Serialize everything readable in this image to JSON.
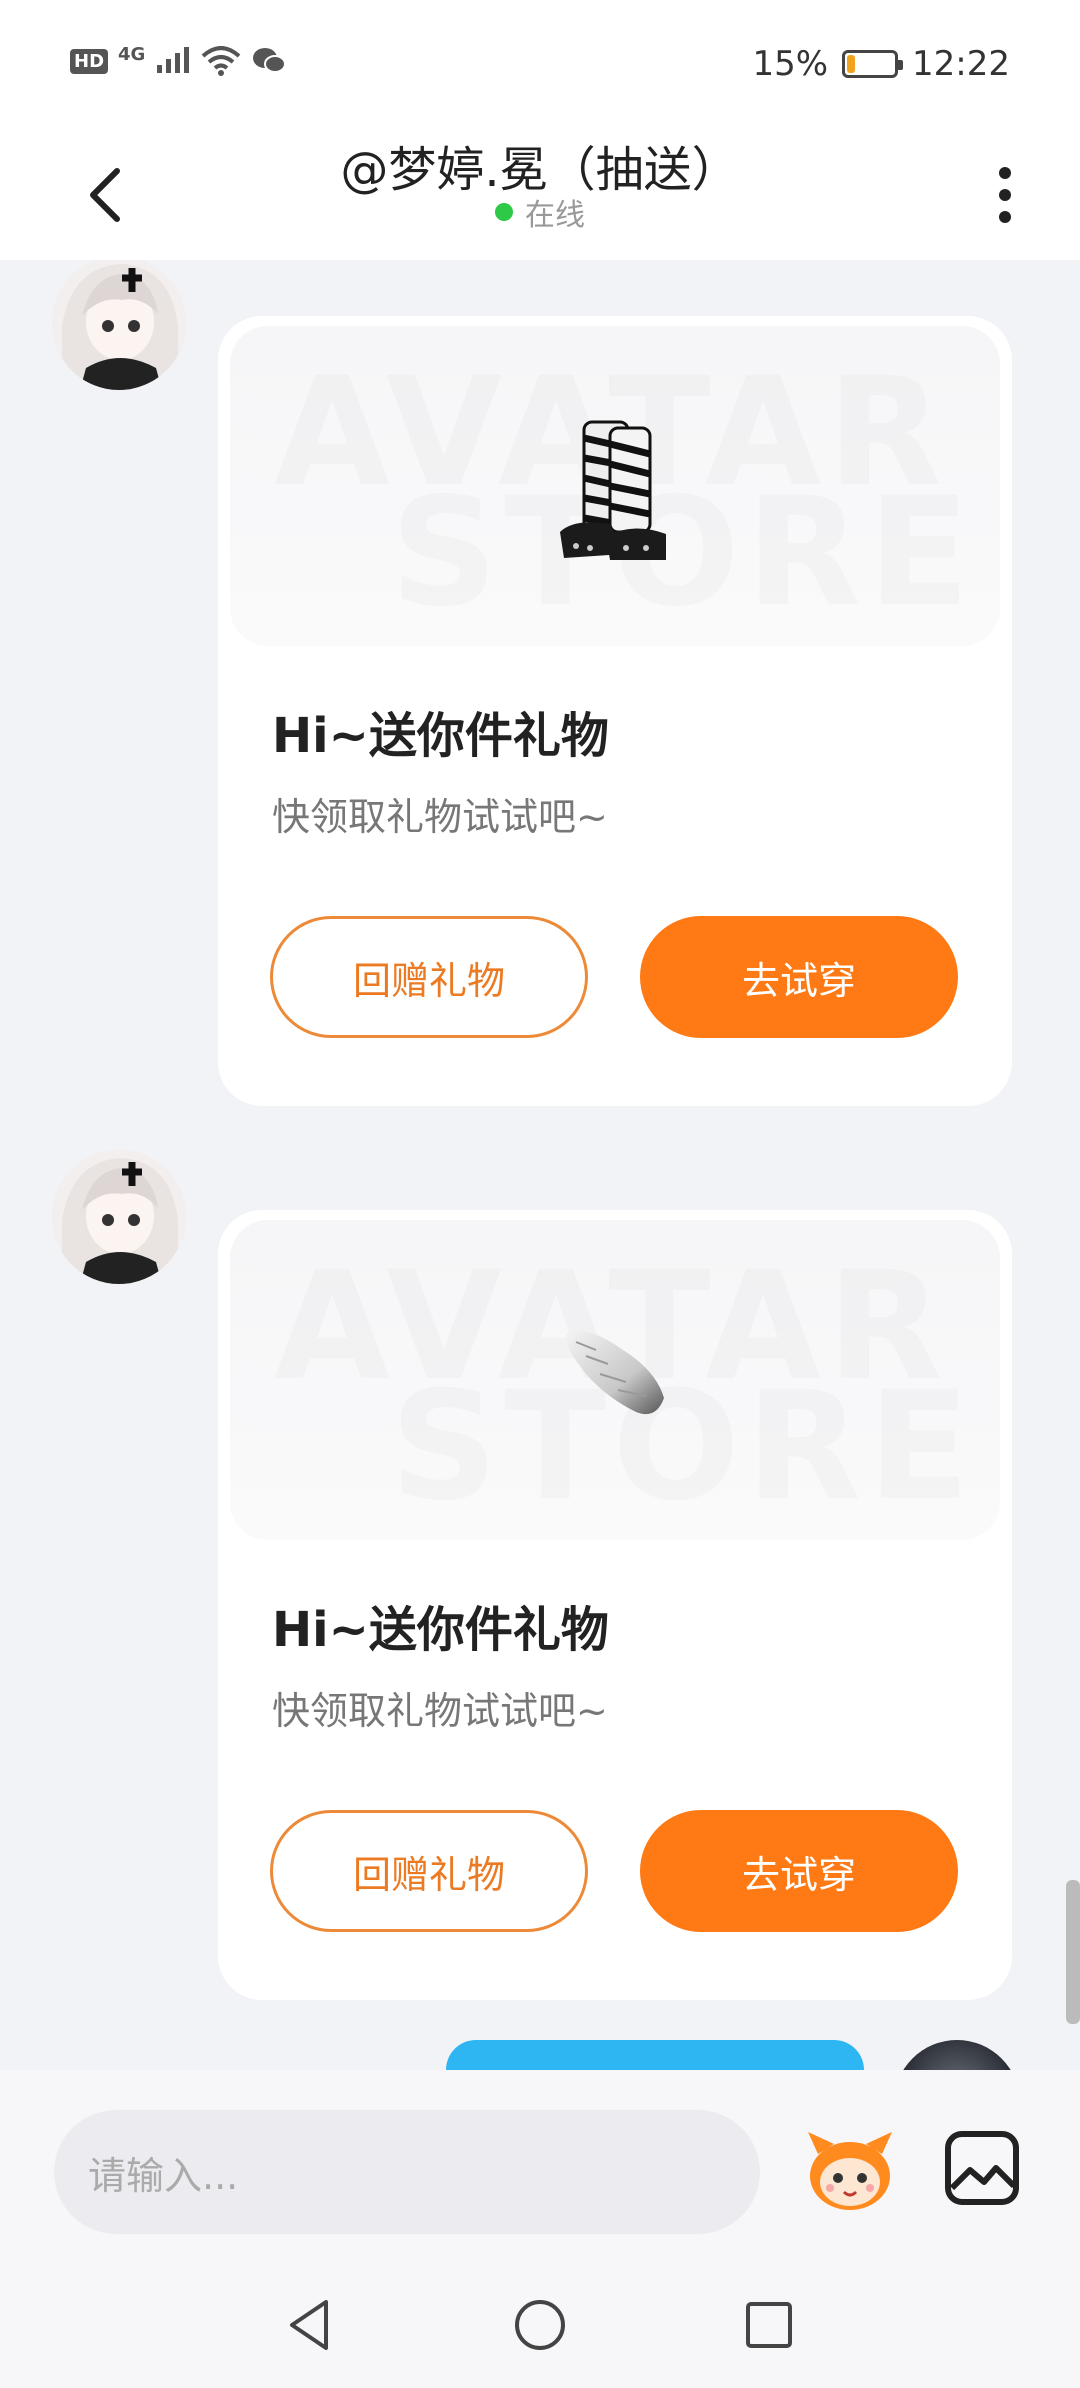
{
  "status_bar": {
    "network_badge": "HD",
    "network_type": "4G",
    "battery_percent_text": "15%",
    "battery_level": 0.15,
    "time": "12:22",
    "icons": [
      "hd-icon",
      "signal-icon",
      "wifi-icon",
      "wechat-icon",
      "battery-icon"
    ]
  },
  "header": {
    "title": "@梦婷.冕（抽送）",
    "status": "在线",
    "status_color": "#2ec946",
    "back_icon": "chevron-left-icon",
    "more_icon": "more-vertical-icon"
  },
  "messages": [
    {
      "type": "gift_card",
      "item": "zebra-boots-icon",
      "banner_text": [
        "AVATAR",
        "STORE"
      ],
      "title": "Hi~送你件礼物",
      "subtitle": "快领取礼物试试吧~",
      "buttons": {
        "return_gift": "回赠礼物",
        "try_on": "去试穿"
      }
    },
    {
      "type": "gift_card",
      "item": "fur-tail-icon",
      "banner_text": [
        "AVATAR",
        "STORE"
      ],
      "title": "Hi~送你件礼物",
      "subtitle": "快领取礼物试试吧~",
      "buttons": {
        "return_gift": "回赠礼物",
        "try_on": "去试穿"
      }
    }
  ],
  "input": {
    "placeholder": "请输入...",
    "emoji_icon": "mascot-icon",
    "image_icon": "image-icon"
  },
  "colors": {
    "accent": "#ff7a14",
    "accent_outline": "#ec8a38",
    "sent_bubble": "#2eb6f2"
  },
  "nav_bar": {
    "icons": [
      "back-triangle-icon",
      "home-circle-icon",
      "recents-square-icon"
    ]
  }
}
